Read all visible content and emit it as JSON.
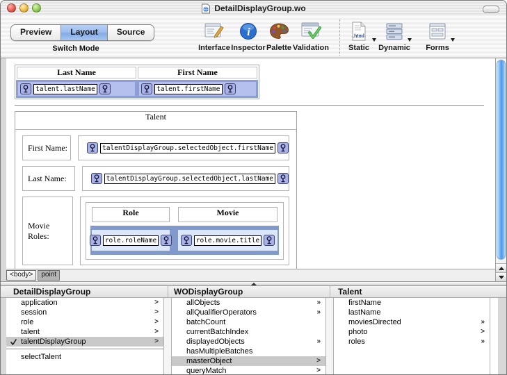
{
  "window": {
    "title": "DetailDisplayGroup.wo"
  },
  "toolbar": {
    "segments": [
      "Preview",
      "Layout",
      "Source"
    ],
    "selected_segment": "Layout",
    "group_label": "Switch Mode",
    "buttons": [
      {
        "label": "Interface",
        "icon": "window-pencil-icon"
      },
      {
        "label": "Inspector",
        "icon": "info-circle-icon",
        "glyph": "i"
      },
      {
        "label": "Palette",
        "icon": "artist-palette-icon"
      },
      {
        "label": "Validation",
        "icon": "window-checkmark-icon"
      }
    ],
    "element_buttons": [
      {
        "label": "Static",
        "icon": "html-file-icon",
        "icon_text": ".html",
        "has_dropdown": true
      },
      {
        "label": "Dynamic",
        "icon": "stacked-fields-icon",
        "has_dropdown": true
      },
      {
        "label": "Forms",
        "icon": "form-window-icon",
        "has_dropdown": true
      }
    ]
  },
  "editor": {
    "top_table": {
      "headers": [
        "Last Name",
        "First Name"
      ],
      "bindings": [
        "talent.lastName",
        "talent.firstName"
      ],
      "selected": true
    },
    "form_table": {
      "title": "Talent",
      "rows": [
        {
          "label": "First Name:",
          "binding": "talentDisplayGroup.selectedObject.firstName"
        },
        {
          "label": "Last Name:",
          "binding": "talentDisplayGroup.selectedObject.lastName"
        }
      ],
      "movie_roles": {
        "label": "Movie Roles:",
        "headers": [
          "Role",
          "Movie"
        ],
        "bindings": [
          "role.roleName",
          "role.movie.title"
        ],
        "selected": true
      }
    },
    "path_bar": [
      {
        "label": "<body>",
        "selected": false
      },
      {
        "label": "point",
        "selected": true
      }
    ]
  },
  "browser": {
    "columns": [
      {
        "title": "DetailDisplayGroup",
        "items": [
          {
            "label": "application",
            "arrow": ">"
          },
          {
            "label": "session",
            "arrow": ">"
          },
          {
            "label": "role",
            "arrow": ">"
          },
          {
            "label": "talent",
            "arrow": ">"
          },
          {
            "label": "talentDisplayGroup",
            "arrow": ">",
            "selected": true,
            "checked": true
          },
          {
            "label": "selectTalent",
            "arrow": "",
            "separator_before": true
          }
        ]
      },
      {
        "title": "WODisplayGroup",
        "items": [
          {
            "label": "allObjects",
            "arrow": "»"
          },
          {
            "label": "allQualifierOperators",
            "arrow": "»"
          },
          {
            "label": "batchCount",
            "arrow": ""
          },
          {
            "label": "currentBatchIndex",
            "arrow": ""
          },
          {
            "label": "displayedObjects",
            "arrow": "»"
          },
          {
            "label": "hasMultipleBatches",
            "arrow": ""
          },
          {
            "label": "masterObject",
            "arrow": ">",
            "selected": true
          },
          {
            "label": "queryMatch",
            "arrow": ">"
          }
        ]
      },
      {
        "title": "Talent",
        "items": [
          {
            "label": "firstName",
            "arrow": ""
          },
          {
            "label": "lastName",
            "arrow": ""
          },
          {
            "label": "moviesDirected",
            "arrow": "»"
          },
          {
            "label": "photo",
            "arrow": ">"
          },
          {
            "label": "roles",
            "arrow": "»"
          }
        ]
      }
    ]
  },
  "colors": {
    "selection_row": "#8c9ed6",
    "selection_cell": "#b5c1ec",
    "nested_band": "#8299cc",
    "nested_cell": "#dce8fa",
    "segment_selected": "#9dbdf0",
    "scrollbar_thumb": "#4d97ea",
    "browser_selection": "#c9c9c9"
  }
}
